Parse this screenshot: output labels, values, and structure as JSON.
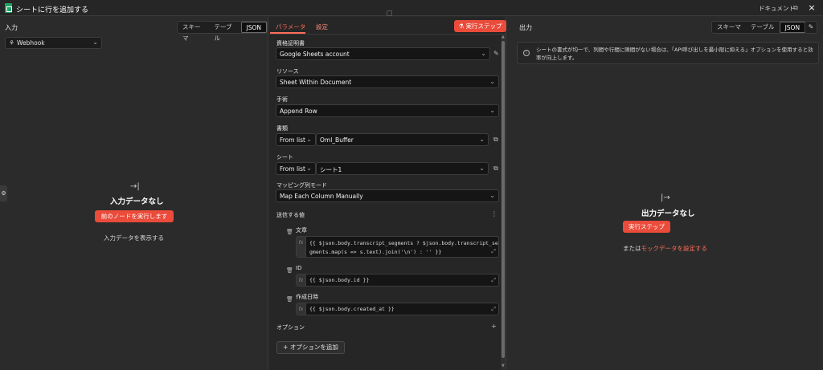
{
  "window": {
    "title": "シートに行を追加する",
    "docs_label": "ドキュメント",
    "docs_icon": "external-link-icon",
    "close_icon": "close-icon"
  },
  "input_panel": {
    "label": "入力",
    "view_tabs": [
      "スキーマ",
      "テーブル",
      "JSON"
    ],
    "active_view": "JSON",
    "node_select": "Webhook",
    "empty_title": "入力データなし",
    "run_previous_button": "前のノードを実行します",
    "show_input_link": "入力データを表示する"
  },
  "parameters_panel": {
    "tabs": [
      "パラメータ",
      "設定"
    ],
    "active_tab": "パラメータ",
    "execute_button": "実行ステップ",
    "fields": {
      "credential": {
        "label": "資格証明書",
        "value": "Google Sheets account"
      },
      "resource": {
        "label": "リソース",
        "value": "Sheet Within Document"
      },
      "operation": {
        "label": "手術",
        "value": "Append Row"
      },
      "document": {
        "label": "書類",
        "mode": "From list",
        "value": "Oml_Buffer"
      },
      "sheet": {
        "label": "シート",
        "mode": "From list",
        "value": "シート1"
      },
      "mapping_mode": {
        "label": "マッピング列モード",
        "value": "Map Each Column Manually"
      }
    },
    "values_to_send": {
      "label": "送信する値",
      "columns": [
        {
          "name": "文章",
          "expression_line1": "{{ $json.body.transcript_segments ? $json.body.transcript_se",
          "expression_line2": "gments.map(s => s.text).join('\\n') : '' }}"
        },
        {
          "name": "ID",
          "expression_line1": "{{ $json.body.id }}"
        },
        {
          "name": "作成日時",
          "expression_line1": "{{ $json.body.created_at }}"
        }
      ]
    },
    "options": {
      "label": "オプション",
      "add_button": "オプションを追加"
    }
  },
  "output_panel": {
    "label": "出力",
    "view_tabs": [
      "スキーマ",
      "テーブル",
      "JSON"
    ],
    "active_view": "JSON",
    "notice": "シートの書式が均一で、列間や行間に隙間がない場合は、「API呼び出しを最小限に抑える」オプションを使用すると効率が向上します。",
    "empty_title": "出力データなし",
    "execute_button": "実行ステップ",
    "mock_prefix": "または",
    "mock_link": "モックデータを設定する"
  },
  "colors": {
    "accent": "#ea4b3a",
    "accent_text": "#ff6d5a",
    "background": "#2b2b2b",
    "panel": "#262626",
    "input": "#151515"
  }
}
